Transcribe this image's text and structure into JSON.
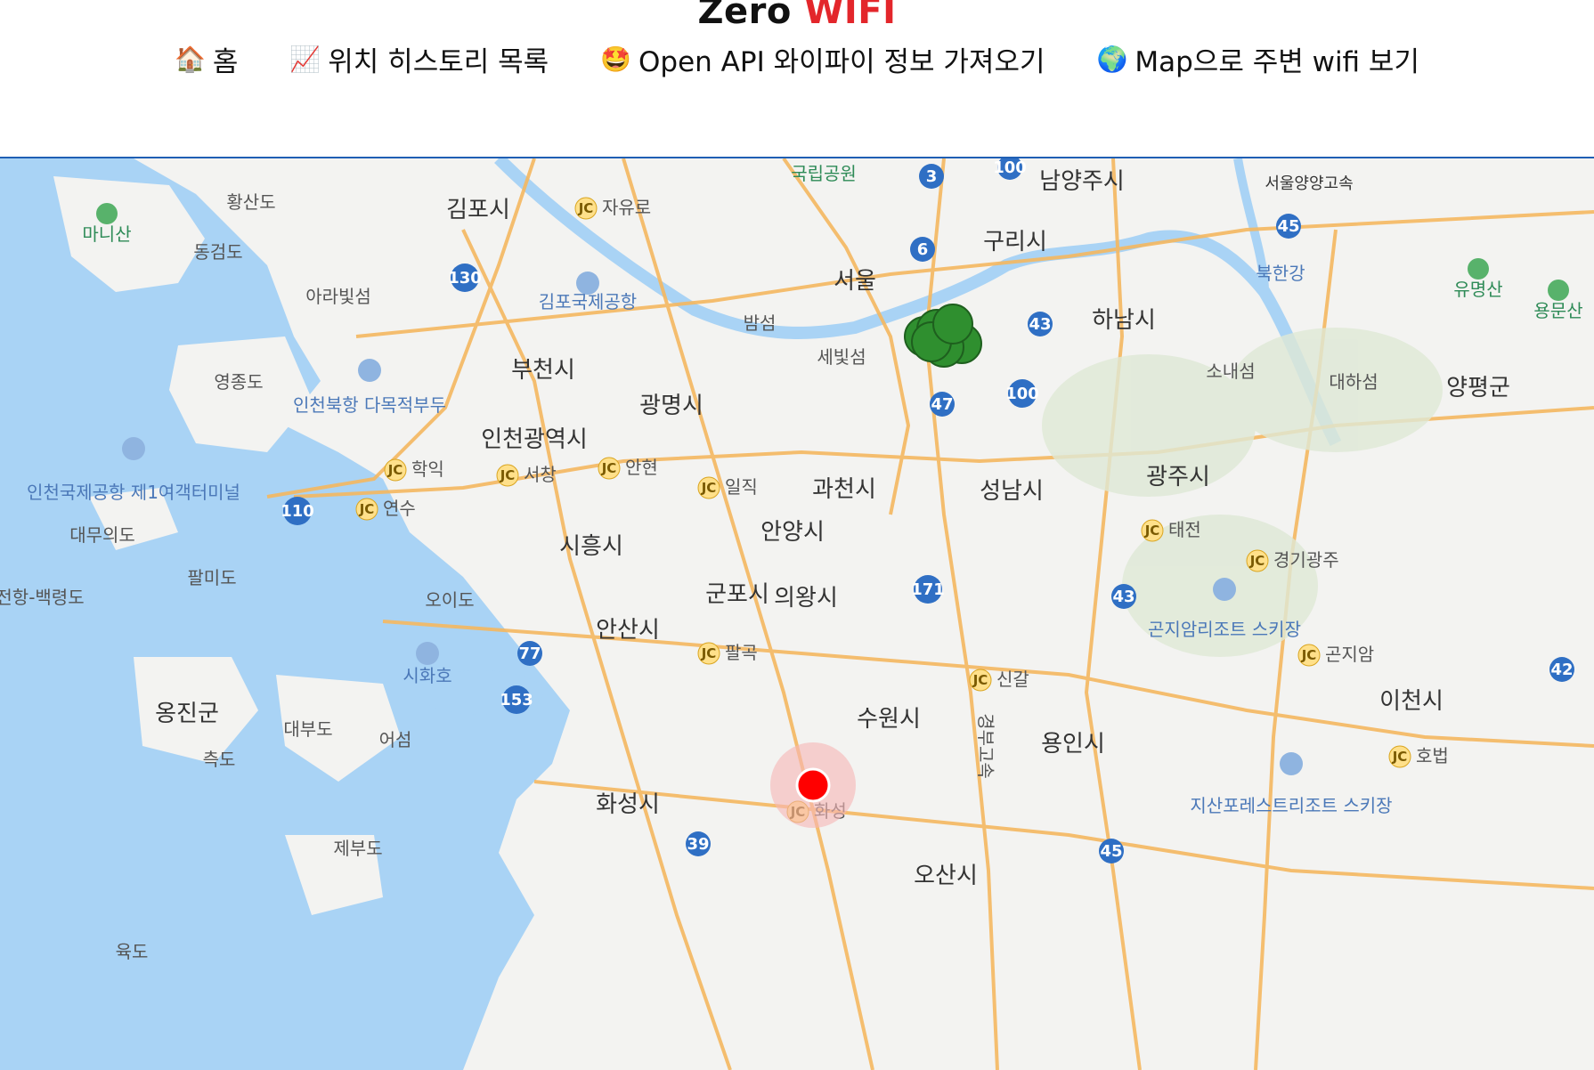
{
  "header": {
    "title_main": "Zero",
    "title_accent": "WIFI",
    "nav": [
      {
        "icon": "🏠",
        "label": "홈"
      },
      {
        "icon": "📈",
        "label": "위치 히스토리 목록"
      },
      {
        "icon": "🤩",
        "label": "Open API 와이파이 정보 가져오기"
      },
      {
        "icon": "🌍",
        "label": "Map으로 주변 wifi 보기"
      }
    ]
  },
  "map": {
    "cities": [
      "남양주시",
      "구리시",
      "서울",
      "하남시",
      "김포시",
      "부천시",
      "광명시",
      "인천광역시",
      "과천시",
      "성남시",
      "광주시",
      "안양시",
      "시흥시",
      "군포시",
      "의왕시",
      "안산시",
      "수원시",
      "용인시",
      "이천시",
      "화성시",
      "오산시",
      "양평군",
      "옹진군"
    ],
    "islands": [
      "황산도",
      "동검도",
      "아라빛섬",
      "영종도",
      "대무의도",
      "팔미도",
      "오이도",
      "대부도",
      "측도",
      "어섬",
      "제부도",
      "육도",
      "소내섬",
      "대하섬",
      "밤섬",
      "세빛섬"
    ],
    "parks": [
      "마니산",
      "국립공원",
      "유명산",
      "용문산"
    ],
    "rivers": [
      "북한강",
      "서울양양고속"
    ],
    "poi": [
      "김포국제공항",
      "인천북항 다목적부두",
      "인천국제공항 제1여객터미널",
      "시화호",
      "곤지암리조트 스키장",
      "지산포레스트리조트 스키장",
      "전항-백령도",
      "경부고속"
    ],
    "junctions": [
      "자유로",
      "학익",
      "서창",
      "안현",
      "일직",
      "연수",
      "태전",
      "경기광주",
      "팔곡",
      "곤지암",
      "신갈",
      "호법",
      "화성"
    ],
    "highways": [
      "3",
      "100",
      "6",
      "45",
      "130",
      "43",
      "47",
      "100",
      "110",
      "171",
      "43",
      "77",
      "153",
      "42",
      "39",
      "45"
    ],
    "marker_current": "red",
    "marker_wifi": "green"
  }
}
